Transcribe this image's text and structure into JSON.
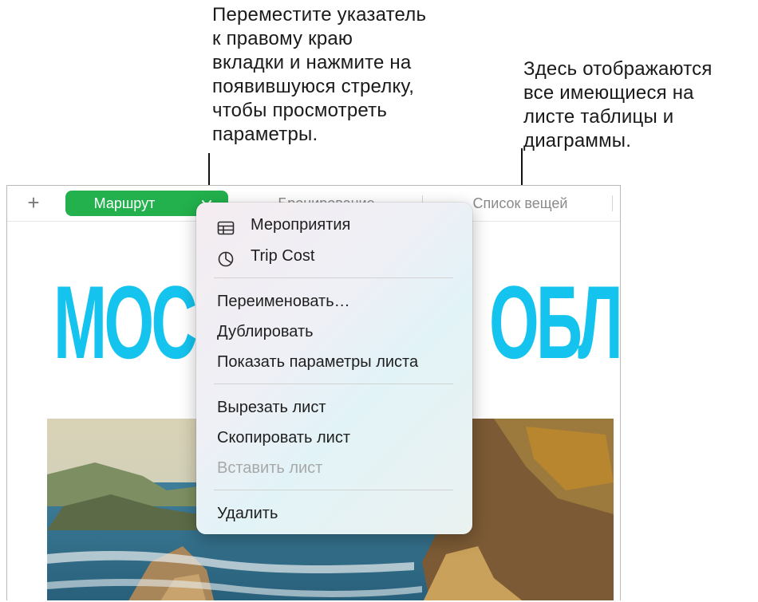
{
  "callouts": {
    "left": "Переместите указатель\nк правому краю\nвкладки и нажмите на\nпоявившуюся стрелку,\nчтобы просмотреть\nпараметры.",
    "right": "Здесь отображаются\nвсе имеющиеся на\nлисте таблицы и\nдиаграммы."
  },
  "tabbar": {
    "add_label": "+",
    "tabs": [
      {
        "label": "Маршрут",
        "active": true
      },
      {
        "label": "Бронирование",
        "active": false
      },
      {
        "label": "Список вещей",
        "active": false
      }
    ]
  },
  "canvas": {
    "headline_left": "МОСК",
    "headline_right": "ОБЛА"
  },
  "menu": {
    "objects": [
      {
        "label": "Мероприятия",
        "icon": "table-icon"
      },
      {
        "label": "Trip Cost",
        "icon": "pie-chart-icon"
      }
    ],
    "sheet_actions": [
      "Переименовать…",
      "Дублировать",
      "Показать параметры листа"
    ],
    "clipboard_actions": [
      {
        "label": "Вырезать лист",
        "enabled": true
      },
      {
        "label": "Скопировать лист",
        "enabled": true
      },
      {
        "label": "Вставить лист",
        "enabled": false
      }
    ],
    "delete_label": "Удалить"
  },
  "colors": {
    "active_tab": "#22b14c",
    "headline": "#14c4ee"
  }
}
